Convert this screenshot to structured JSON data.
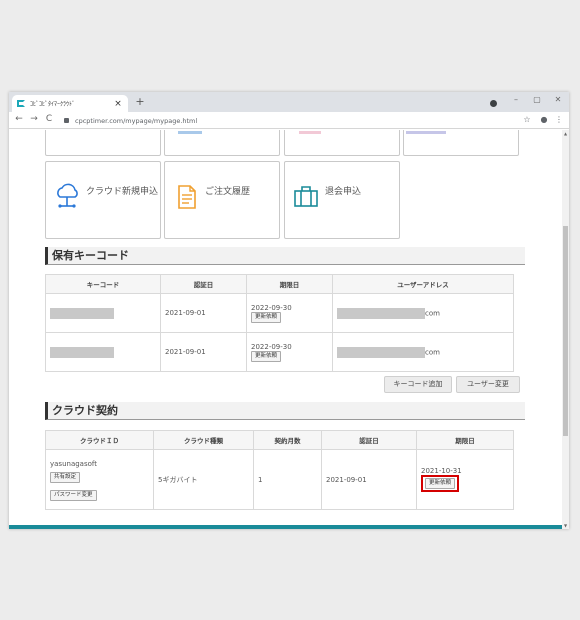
{
  "browser": {
    "tab_title": "ｺﾋﾟｺﾋﾟﾀｲﾏｰｸﾗｳﾄﾞ",
    "tab_close": "×",
    "new_tab": "+",
    "url": "cpcptimer.com/mypage/mypage.html",
    "back": "←",
    "forward": "→",
    "reload": "C",
    "minimize": "–",
    "maximize": "▢",
    "close": "✕",
    "star": "☆",
    "profile": "●",
    "menu": "⋮"
  },
  "menu_cards": [
    {
      "label": "クラウド新規申込",
      "icon": "cloud-upload-icon"
    },
    {
      "label": "ご注文履歴",
      "icon": "order-history-icon"
    },
    {
      "label": "退会申込",
      "icon": "briefcase-icon"
    }
  ],
  "keycodes": {
    "heading": "保有キーコード",
    "headers": [
      "キーコード",
      "認証日",
      "期限日",
      "ユーザーアドレス"
    ],
    "rows": [
      {
        "auth_date": "2021-09-01",
        "expiry": "2022-09-30",
        "renew": "更新依頼",
        "email_suffix": "com"
      },
      {
        "auth_date": "2021-09-01",
        "expiry": "2022-09-30",
        "renew": "更新依頼",
        "email_suffix": "com"
      }
    ],
    "add_button": "キーコード追加",
    "user_change_button": "ユーザー変更"
  },
  "cloud": {
    "heading": "クラウド契約",
    "headers": [
      "クラウドＩＤ",
      "クラウド種類",
      "契約月数",
      "認証日",
      "期限日"
    ],
    "row": {
      "id": "yasunagasoft",
      "share_button": "共有設定",
      "password_button": "パスワード変更",
      "type": "5ギガバイト",
      "months": "1",
      "auth_date": "2021-09-01",
      "expiry": "2021-10-31",
      "renew": "更新依頼"
    }
  },
  "colors": {
    "accent_teal": "#1aa7b8",
    "highlight_red": "#d40000",
    "icon_orange": "#f0a030",
    "icon_blue": "#2b78d8",
    "icon_teal": "#1a8b99"
  }
}
